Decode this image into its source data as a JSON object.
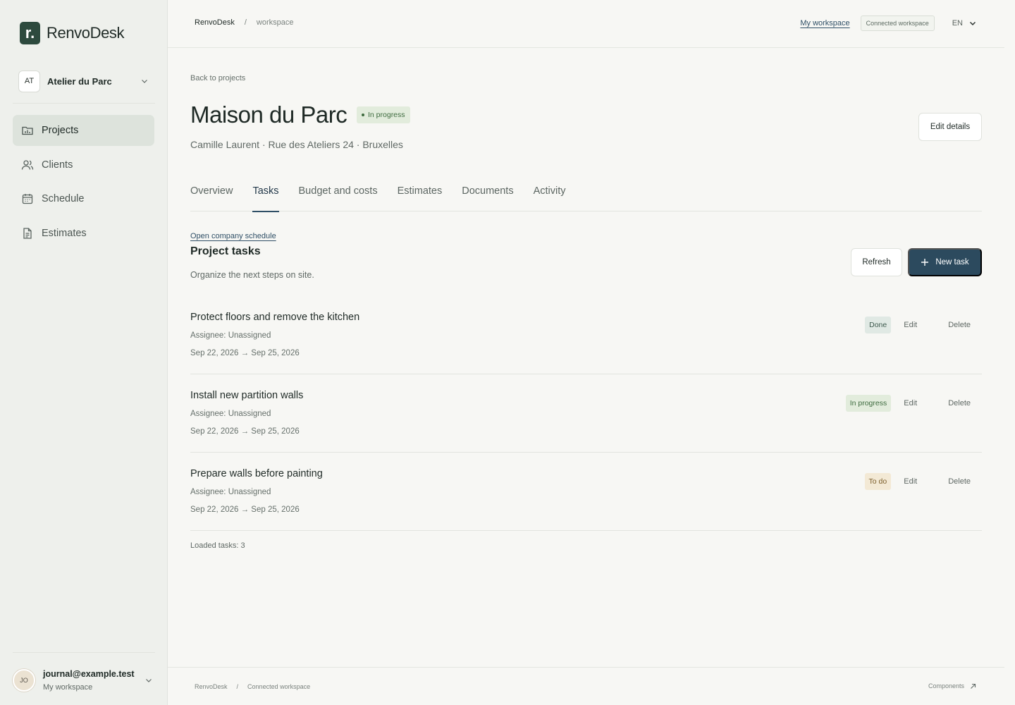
{
  "brand": {
    "logo_letter": "r.",
    "name": "RenvoDesk"
  },
  "org": {
    "initials": "AT",
    "name": "Atelier du Parc"
  },
  "sidebar": {
    "items": [
      {
        "label": "Projects",
        "icon": "folder-icon",
        "active": true
      },
      {
        "label": "Clients",
        "icon": "users-icon",
        "active": false
      },
      {
        "label": "Schedule",
        "icon": "calendar-icon",
        "active": false
      },
      {
        "label": "Estimates",
        "icon": "document-icon",
        "active": false
      }
    ]
  },
  "user": {
    "initials": "JO",
    "email": "journal@example.test",
    "workspace": "My workspace"
  },
  "topbar": {
    "breadcrumb_app": "RenvoDesk",
    "breadcrumb_sep": "/",
    "breadcrumb_page": "workspace",
    "my_workspace_link": "My workspace",
    "connected_badge": "Connected workspace",
    "language": "EN"
  },
  "project": {
    "back_link": "Back to projects",
    "title": "Maison du Parc",
    "status": "In progress",
    "subtitle": "Camille Laurent · Rue des Ateliers 24 · Bruxelles",
    "edit_details": "Edit details"
  },
  "tabs": [
    {
      "label": "Overview",
      "active": false
    },
    {
      "label": "Tasks",
      "active": true
    },
    {
      "label": "Budget and costs",
      "active": false
    },
    {
      "label": "Estimates",
      "active": false
    },
    {
      "label": "Documents",
      "active": false
    },
    {
      "label": "Activity",
      "active": false
    }
  ],
  "tasks_section": {
    "schedule_link": "Open company schedule",
    "title": "Project tasks",
    "subtitle": "Organize the next steps on site.",
    "refresh": "Refresh",
    "new_task": "New task",
    "loaded": "Loaded tasks: 3"
  },
  "tasks": [
    {
      "title": "Protect floors and remove the kitchen",
      "assignee": "Assignee: Unassigned",
      "dates": "Sep 22, 2026 → Sep 25, 2026",
      "status": "Done",
      "status_kind": "done",
      "edit": "Edit",
      "delete": "Delete"
    },
    {
      "title": "Install new partition walls",
      "assignee": "Assignee: Unassigned",
      "dates": "Sep 22, 2026 → Sep 25, 2026",
      "status": "In progress",
      "status_kind": "prog",
      "edit": "Edit",
      "delete": "Delete"
    },
    {
      "title": "Prepare walls before painting",
      "assignee": "Assignee: Unassigned",
      "dates": "Sep 22, 2026 → Sep 25, 2026",
      "status": "To do",
      "status_kind": "todo",
      "edit": "Edit",
      "delete": "Delete"
    }
  ],
  "footer": {
    "app": "RenvoDesk",
    "sep": "/",
    "workspace": "Connected workspace",
    "components_link": "Components"
  },
  "colors": {
    "accent": "#2c4a5e",
    "brand": "#2d4a3e",
    "sidebar_bg": "#eef0ec",
    "page_bg": "#f7f7f4"
  }
}
